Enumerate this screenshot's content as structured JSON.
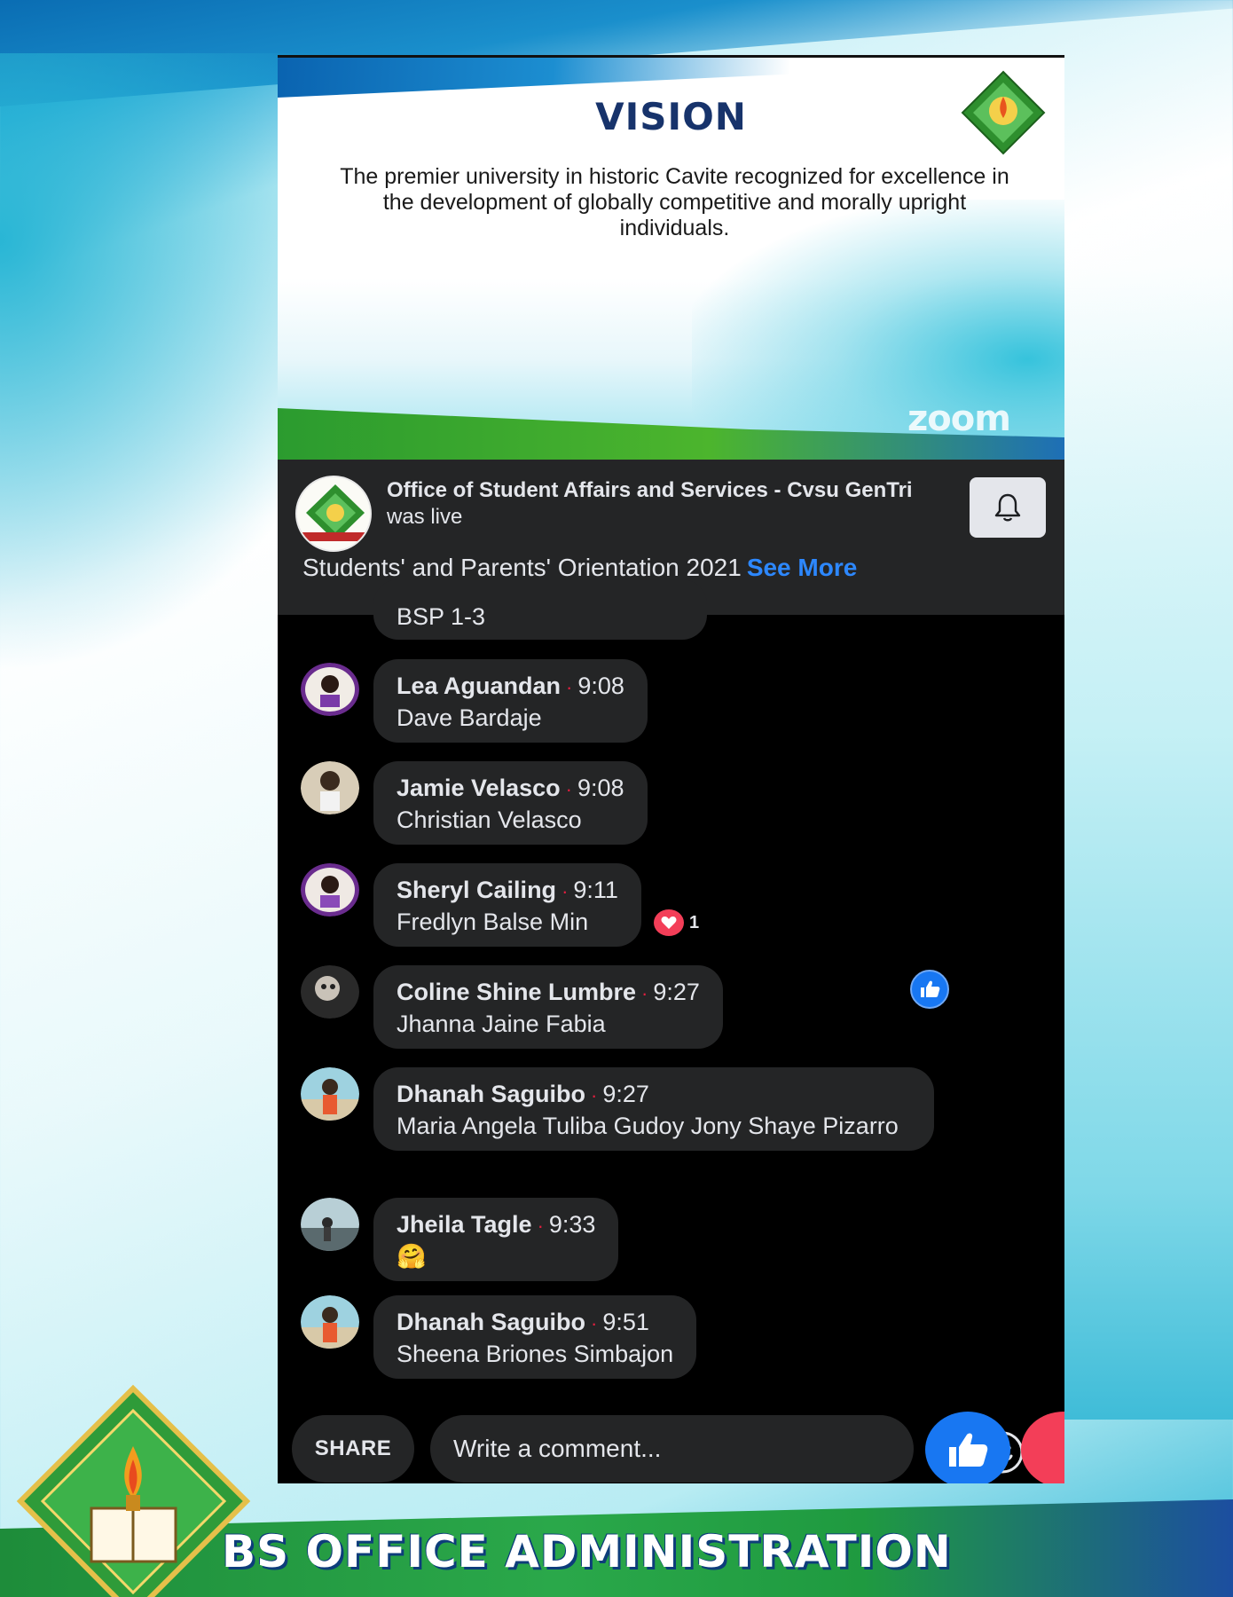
{
  "slide": {
    "title": "VISION",
    "text": "The premier university  in historic Cavite recognized for excellence in the development of globally competitive and morally upright individuals.",
    "watermark": "zoom"
  },
  "live": {
    "page_name": "Office of Student Affairs and Services - Cvsu GenTri",
    "status": " was live",
    "description": "Students' and Parents' Orientation 2021",
    "see_more": "See More",
    "bell_icon": "bell-icon"
  },
  "comments": {
    "partial_text": "BSP 1-3",
    "items": [
      {
        "name": "Lea Aguandan",
        "time": "9:08",
        "text": "Dave Bardaje"
      },
      {
        "name": "Jamie Velasco",
        "time": "9:08",
        "text": "Christian Velasco"
      },
      {
        "name": "Sheryl Cailing",
        "time": "9:11",
        "text": "Fredlyn Balse Min",
        "reaction_count": "1"
      },
      {
        "name": "Coline Shine Lumbre",
        "time": "9:27",
        "text": "Jhanna Jaine Fabia"
      },
      {
        "name": "Dhanah Saguibo",
        "time": "9:27",
        "text": "Maria Angela Tuliba Gudoy Jony Shaye Pizarro"
      },
      {
        "name": "Jheila Tagle",
        "time": "9:33",
        "text": "🤗"
      },
      {
        "name": "Dhanah Saguibo",
        "time": "9:51",
        "text": "Sheena Briones Simbajon"
      }
    ],
    "separator": "·"
  },
  "bottom_bar": {
    "share_label": "SHARE",
    "comment_placeholder": "Write a comment..."
  },
  "footer": {
    "program_title": "BS OFFICE ADMINISTRATION"
  },
  "colors": {
    "accent_blue": "#2d88ff",
    "like_blue": "#1877f2",
    "love_red": "#f33e58",
    "bubble": "#242526"
  }
}
